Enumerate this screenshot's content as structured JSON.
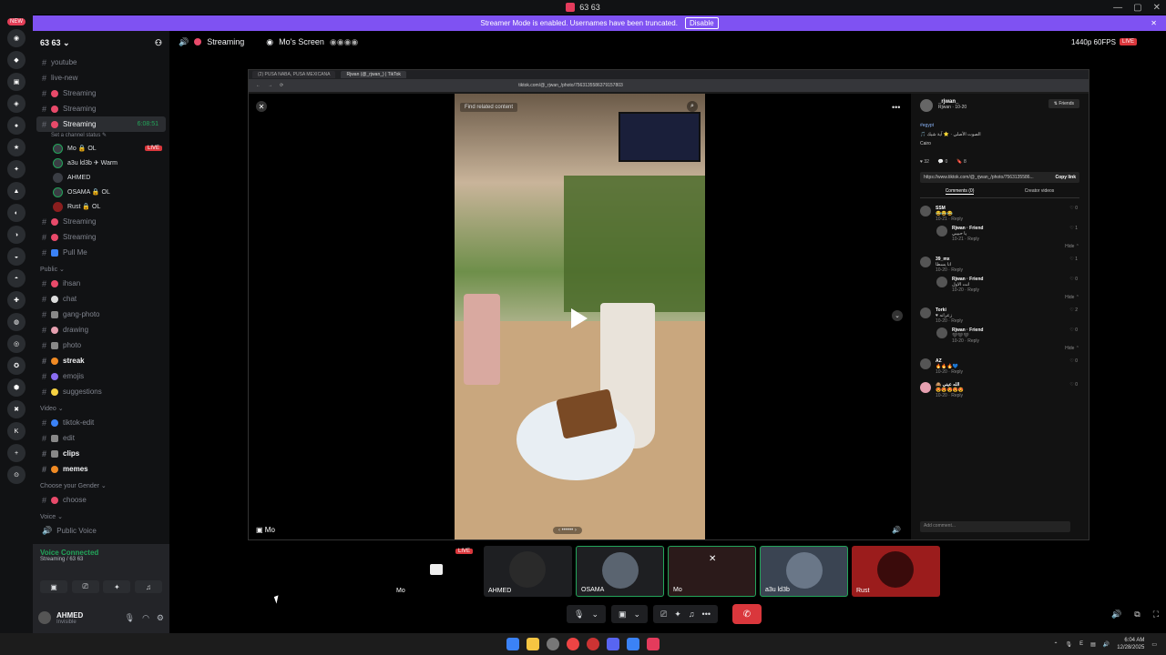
{
  "window": {
    "title": "63 63",
    "controls": [
      "—",
      "▢",
      "✕"
    ]
  },
  "banner": {
    "text": "Streamer Mode is enabled. Usernames have been truncated.",
    "disable_label": "Disable",
    "close": "✕"
  },
  "rail": {
    "new_badge": "NEW"
  },
  "guild": {
    "name": "63 63 ⌄"
  },
  "channels_top": [
    {
      "label": "youtube",
      "icon": "#"
    },
    {
      "label": "live-new",
      "icon": "#"
    },
    {
      "label": "Streaming",
      "icon": "🔴"
    },
    {
      "label": "Streaming",
      "icon": "🔴"
    }
  ],
  "active_channel": {
    "label": "Streaming",
    "time": "6:08:51",
    "status": "Set a channel status ✎"
  },
  "voice_users": [
    {
      "name": "Mo 🔒 OL",
      "live": "LIVE"
    },
    {
      "name": "a3u ld3b ✈ Warm",
      "live": ""
    },
    {
      "name": "AHMED",
      "live": ""
    },
    {
      "name": "OSAMA 🔒 OL",
      "live": ""
    },
    {
      "name": "Rust 🔒 OL",
      "live": ""
    }
  ],
  "channels_mid": [
    {
      "label": "Streaming"
    },
    {
      "label": "Streaming"
    },
    {
      "label": "Pull Me"
    }
  ],
  "cat_public": "Public ⌄",
  "public_channels": [
    {
      "label": "ihsan",
      "bold": false
    },
    {
      "label": "chat",
      "bold": false
    },
    {
      "label": "gang-photo",
      "bold": false
    },
    {
      "label": "drawing",
      "bold": false
    },
    {
      "label": "photo",
      "bold": false
    },
    {
      "label": "streak",
      "bold": true
    },
    {
      "label": "emojis",
      "bold": false
    },
    {
      "label": "suggestions",
      "bold": false
    }
  ],
  "cat_video": "Video ⌄",
  "video_channels": [
    {
      "label": "tiktok-edit",
      "bold": false
    },
    {
      "label": "edit",
      "bold": false
    },
    {
      "label": "clips",
      "bold": true
    },
    {
      "label": "memes",
      "bold": true
    }
  ],
  "cat_gender": "Choose your Gender ⌄",
  "gender_channels": [
    {
      "label": "choose"
    }
  ],
  "cat_voice": "Voice ⌄",
  "voice_channels": [
    {
      "label": "Public Voice"
    }
  ],
  "voice_panel": {
    "title": "Voice Connected",
    "sub": "Streaming / 63 63"
  },
  "user": {
    "name": "AHMED",
    "status": "Invisible"
  },
  "stage": {
    "title": "Streaming",
    "screen_label": "Mo's Screen",
    "quality": "1440p 60FPS",
    "live": "LIVE"
  },
  "browser": {
    "tab1": "(2) PUSA NABA, PUSA MEXICANA",
    "tab2": "Rjwan (@_rjwan_) | TikTok",
    "url": "tiktok.com/@_rjwan_/photo/7563135586379157803"
  },
  "video": {
    "find_label": "Find related content",
    "stream_owner": "Mo"
  },
  "tiktok": {
    "author": "_rjwan_",
    "author_sub": "Rjwan · 10-20",
    "friends": "⇅ Friends",
    "tag": "#egypt",
    "desc": "🎵 الصوت الأصلي · ⭐ آية شيك",
    "location": "Cairo",
    "stats": [
      "♥ 32",
      "💬 0",
      "🔖 8"
    ],
    "link": "https://www.tiktok.com/@_rjwan_/photo/7563135586...",
    "copy": "Copy link",
    "tab_comments": "Comments (0)",
    "tab_creator": "Creator videos",
    "comments": [
      {
        "name": "SSM",
        "text": "😂😂😂",
        "meta": "10-21 · Reply",
        "likes": "0",
        "reply": {
          "name": "Rjwan · Friend",
          "text": "يا حبيبي",
          "meta": "10-21 · Reply",
          "likes": "1"
        }
      },
      {
        "name": "39_mx",
        "text": "انا يسطا",
        "meta": "10-20 · Reply",
        "likes": "1",
        "reply": {
          "name": "Rjwan · Friend",
          "text": "انت الاول",
          "meta": "10-20 · Reply",
          "likes": "0"
        }
      },
      {
        "name": "Torki",
        "text": "♥ زعرانه",
        "meta": "10-20 · Reply",
        "likes": "2",
        "reply": {
          "name": "Rjwan · Friend",
          "text": "🖤🖤🖤",
          "meta": "10-20 · Reply",
          "likes": "0"
        }
      },
      {
        "name": "AZ",
        "text": "🔥🔥🔥💙",
        "meta": "10-20 · Reply",
        "likes": "0",
        "reply": null
      },
      {
        "name": "🙈 الله عيني",
        "text": "😍😍😍😍😍",
        "meta": "10-20 · Reply",
        "likes": "0",
        "reply": null
      }
    ],
    "hide": "Hide ⌃",
    "add_comment": "Add comment..."
  },
  "tiles": [
    {
      "label": "Mo",
      "live": "LIVE"
    },
    {
      "label": "AHMED",
      "live": ""
    },
    {
      "label": "OSAMA",
      "live": ""
    },
    {
      "label": "Mo",
      "live": ""
    },
    {
      "label": "a3u ld3b",
      "live": ""
    },
    {
      "label": "Rust",
      "live": ""
    }
  ],
  "taskbar": {
    "time": "6:04 AM",
    "date": "12/28/2025",
    "lang": "E"
  }
}
